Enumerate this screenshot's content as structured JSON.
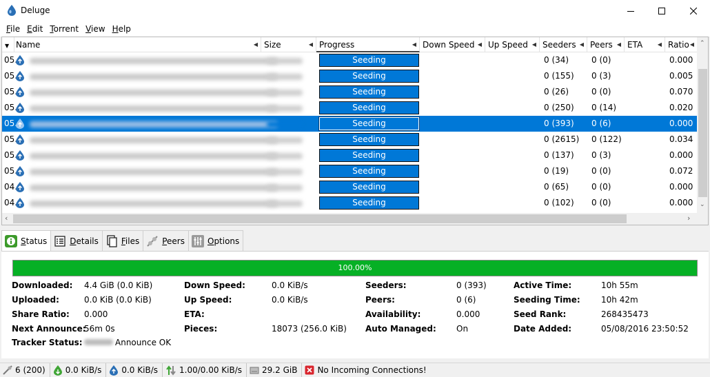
{
  "window": {
    "title": "Deluge"
  },
  "menu": [
    "File",
    "Edit",
    "Torrent",
    "View",
    "Help"
  ],
  "columns": {
    "name": "Name",
    "size": "Size",
    "progress": "Progress",
    "down_speed": "Down Speed",
    "up_speed": "Up Speed",
    "seeders": "Seeders",
    "peers": "Peers",
    "eta": "ETA",
    "ratio": "Ratio"
  },
  "torrents": [
    {
      "date": "05.",
      "progress": "Seeding",
      "progress_value": 1.0,
      "seeders": "0 (34)",
      "peers": "0 (0)",
      "ratio": "0.000",
      "selected": false
    },
    {
      "date": "05.",
      "progress": "Seeding",
      "progress_value": 1.0,
      "seeders": "0 (155)",
      "peers": "0 (3)",
      "ratio": "0.005",
      "selected": false
    },
    {
      "date": "05.",
      "progress": "Seeding",
      "progress_value": 1.0,
      "seeders": "0 (26)",
      "peers": "0 (0)",
      "ratio": "0.070",
      "selected": false
    },
    {
      "date": "05.",
      "progress": "Seeding",
      "progress_value": 1.0,
      "seeders": "0 (250)",
      "peers": "0 (14)",
      "ratio": "0.020",
      "selected": false
    },
    {
      "date": "05.",
      "progress": "Seeding",
      "progress_value": 1.0,
      "seeders": "0 (393)",
      "peers": "0 (6)",
      "ratio": "0.000",
      "selected": true
    },
    {
      "date": "05.",
      "progress": "Seeding",
      "progress_value": 1.0,
      "seeders": "0 (2615)",
      "peers": "0 (122)",
      "ratio": "0.034",
      "selected": false
    },
    {
      "date": "05.",
      "progress": "Seeding",
      "progress_value": 1.0,
      "seeders": "0 (137)",
      "peers": "0 (3)",
      "ratio": "0.000",
      "selected": false
    },
    {
      "date": "05.",
      "progress": "Seeding",
      "progress_value": 1.0,
      "seeders": "0 (19)",
      "peers": "0 (0)",
      "ratio": "0.072",
      "selected": false
    },
    {
      "date": "04.",
      "progress": "Seeding",
      "progress_value": 1.0,
      "seeders": "0 (65)",
      "peers": "0 (0)",
      "ratio": "0.000",
      "selected": false
    },
    {
      "date": "04.",
      "progress": "Seeding",
      "progress_value": 1.0,
      "seeders": "0 (102)",
      "peers": "0 (0)",
      "ratio": "0.000",
      "selected": false
    }
  ],
  "tabs": [
    {
      "label": "Status",
      "icon": "info-icon",
      "active": true
    },
    {
      "label": "Details",
      "icon": "details-icon",
      "active": false
    },
    {
      "label": "Files",
      "icon": "files-icon",
      "active": false
    },
    {
      "label": "Peers",
      "icon": "peers-icon",
      "active": false
    },
    {
      "label": "Options",
      "icon": "options-icon",
      "active": false
    }
  ],
  "status": {
    "progress_text": "100.00%",
    "progress_value": 1.0,
    "downloaded_label": "Downloaded:",
    "downloaded": "4.4 GiB (0.0 KiB)",
    "uploaded_label": "Uploaded:",
    "uploaded": "0.0 KiB (0.0 KiB)",
    "share_ratio_label": "Share Ratio:",
    "share_ratio": "0.000",
    "next_announce_label": "Next Announce:",
    "next_announce": "56m 0s",
    "tracker_status_label": "Tracker Status:",
    "tracker_status": "Announce OK",
    "down_speed_label": "Down Speed:",
    "down_speed": "0.0 KiB/s",
    "up_speed_label": "Up Speed:",
    "up_speed": "0.0 KiB/s",
    "eta_label": "ETA:",
    "eta": "",
    "pieces_label": "Pieces:",
    "pieces": "18073 (256.0 KiB)",
    "seeders_label": "Seeders:",
    "seeders": "0 (393)",
    "peers_label": "Peers:",
    "peers": "0 (6)",
    "availability_label": "Availability:",
    "availability": "0.000",
    "auto_managed_label": "Auto Managed:",
    "auto_managed": "On",
    "active_time_label": "Active Time:",
    "active_time": "10h 55m",
    "seeding_time_label": "Seeding Time:",
    "seeding_time": "10h 42m",
    "seed_rank_label": "Seed Rank:",
    "seed_rank": "268435473",
    "date_added_label": "Date Added:",
    "date_added": "05/08/2016 23:50:52"
  },
  "statusbar": {
    "connections": "6 (200)",
    "download_speed": "0.0 KiB/s",
    "upload_speed": "0.0 KiB/s",
    "protocol_traffic": "1.00/0.00 KiB/s",
    "free_space": "29.2 GiB",
    "incoming": "No Incoming Connections!"
  },
  "colors": {
    "accent": "#0078d7",
    "progress_green": "#06b025",
    "warning_red": "#d9262e"
  }
}
